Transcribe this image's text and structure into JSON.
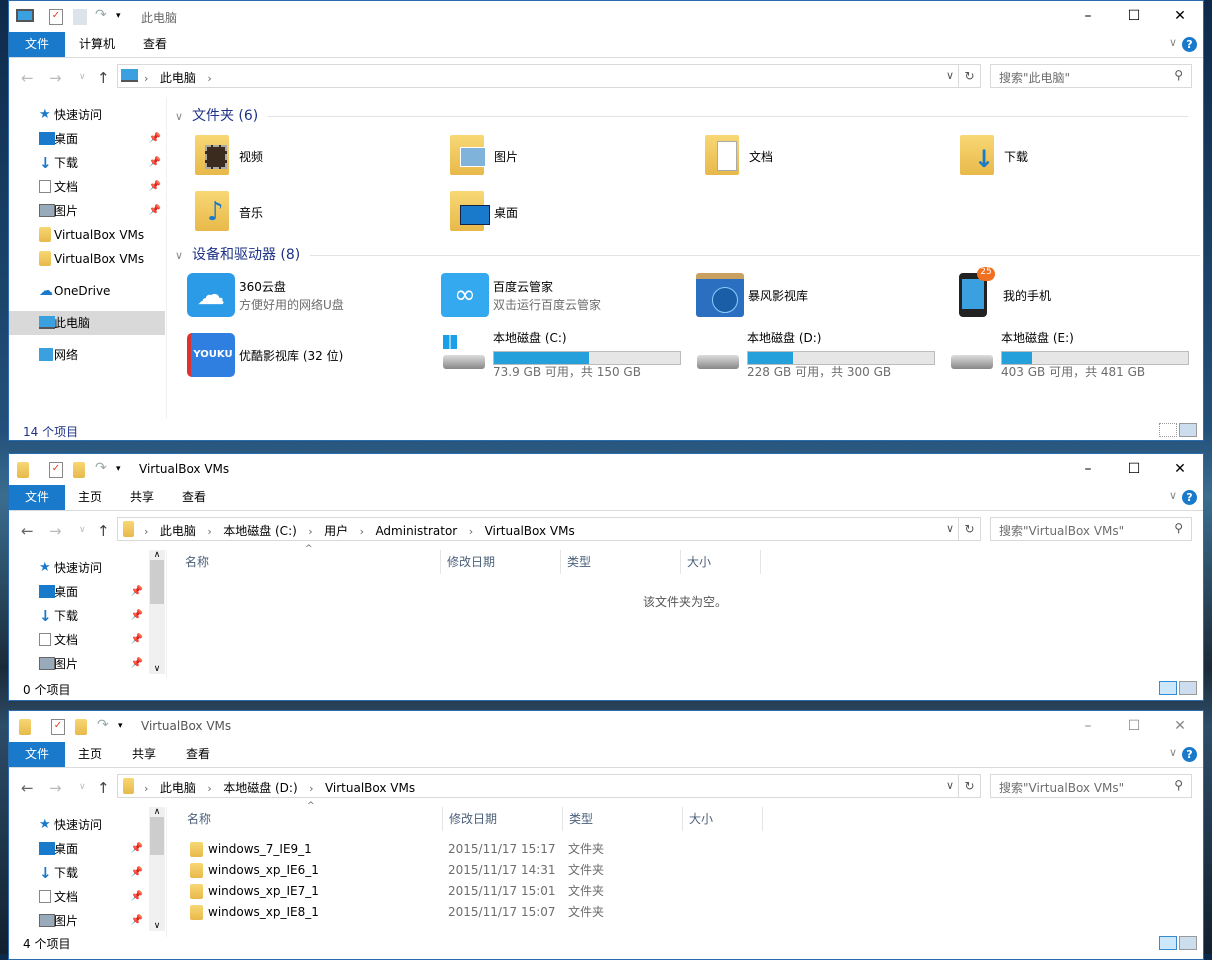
{
  "w1": {
    "title": "此电脑",
    "tabs": [
      "文件",
      "计算机",
      "查看"
    ],
    "crumbs": [
      "此电脑"
    ],
    "search": "搜索\"此电脑\"",
    "nav": [
      {
        "label": "快速访问"
      },
      {
        "label": "桌面",
        "pin": true
      },
      {
        "label": "下载",
        "pin": true
      },
      {
        "label": "文档",
        "pin": true
      },
      {
        "label": "图片",
        "pin": true
      },
      {
        "label": "VirtualBox VMs"
      },
      {
        "label": "VirtualBox VMs"
      },
      {
        "label": "OneDrive"
      },
      {
        "label": "此电脑",
        "selected": true
      },
      {
        "label": "网络"
      }
    ],
    "folders_header": "文件夹 (6)",
    "folders": [
      "视频",
      "图片",
      "文档",
      "下载",
      "音乐",
      "桌面"
    ],
    "devices_header": "设备和驱动器 (8)",
    "devices": [
      {
        "name": "360云盘",
        "sub": "方便好用的网络U盘"
      },
      {
        "name": "百度云管家",
        "sub": "双击运行百度云管家"
      },
      {
        "name": "暴风影视库"
      },
      {
        "name": "我的手机",
        "badge": "25"
      },
      {
        "name": "优酷影视库 (32 位)",
        "logo": "YOUKU"
      }
    ],
    "drives": [
      {
        "name": "本地磁盘 (C:)",
        "free": "73.9 GB 可用，共 150 GB",
        "used_pct": 51
      },
      {
        "name": "本地磁盘 (D:)",
        "free": "228 GB 可用，共 300 GB",
        "used_pct": 24
      },
      {
        "name": "本地磁盘 (E:)",
        "free": "403 GB 可用，共 481 GB",
        "used_pct": 16
      }
    ],
    "status": "14 个项目"
  },
  "w2": {
    "title": "VirtualBox VMs",
    "tabs": [
      "文件",
      "主页",
      "共享",
      "查看"
    ],
    "crumbs": [
      "此电脑",
      "本地磁盘 (C:)",
      "用户",
      "Administrator",
      "VirtualBox VMs"
    ],
    "search": "搜索\"VirtualBox VMs\"",
    "nav": [
      "快速访问",
      "桌面",
      "下载",
      "文档",
      "图片"
    ],
    "columns": [
      "名称",
      "修改日期",
      "类型",
      "大小"
    ],
    "empty": "该文件夹为空。",
    "status": "0 个项目"
  },
  "w3": {
    "title": "VirtualBox VMs",
    "tabs": [
      "文件",
      "主页",
      "共享",
      "查看"
    ],
    "crumbs": [
      "此电脑",
      "本地磁盘 (D:)",
      "VirtualBox VMs"
    ],
    "search": "搜索\"VirtualBox VMs\"",
    "nav": [
      "快速访问",
      "桌面",
      "下载",
      "文档",
      "图片"
    ],
    "columns": [
      "名称",
      "修改日期",
      "类型",
      "大小"
    ],
    "rows": [
      {
        "name": "windows_7_IE9_1",
        "date": "2015/11/17 15:17",
        "type": "文件夹"
      },
      {
        "name": "windows_xp_IE6_1",
        "date": "2015/11/17 14:31",
        "type": "文件夹"
      },
      {
        "name": "windows_xp_IE7_1",
        "date": "2015/11/17 15:01",
        "type": "文件夹"
      },
      {
        "name": "windows_xp_IE8_1",
        "date": "2015/11/17 15:07",
        "type": "文件夹"
      }
    ],
    "status": "4 个项目"
  },
  "colors": {
    "accent": "#1979ca",
    "header_text": "#1e3287",
    "bar": "#26a0da"
  }
}
